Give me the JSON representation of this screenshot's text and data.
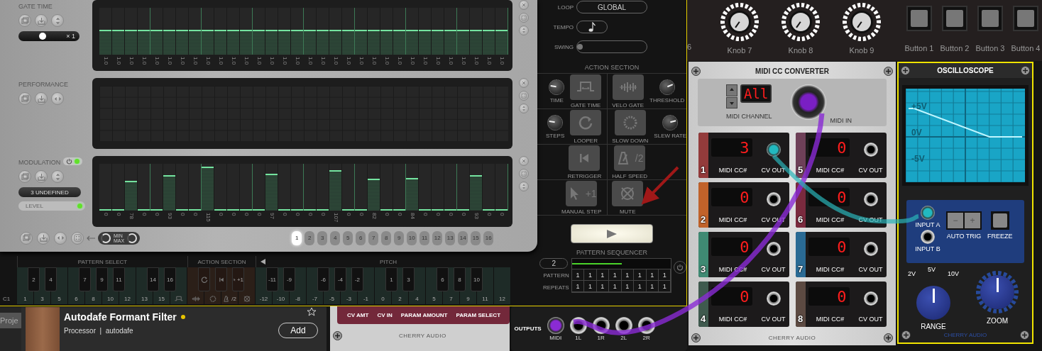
{
  "sequencer": {
    "lanes": [
      {
        "kind": "bars",
        "title": "GATE TIME",
        "scale": {
          "label": "× 1",
          "level": 0.4
        },
        "steps": [
          {
            "label": "1.0",
            "level": 0.5
          },
          {
            "label": "1.0",
            "level": 0.5
          },
          {
            "label": "1.0",
            "level": 0.5
          },
          {
            "label": "1.0",
            "level": 0.5
          },
          {
            "label": "1.0",
            "level": 0.5
          },
          {
            "label": "1.0",
            "level": 0.5
          },
          {
            "label": "1.0",
            "level": 0.5
          },
          {
            "label": "1.0",
            "level": 0.5
          },
          {
            "label": "1.0",
            "level": 0.5
          },
          {
            "label": "1.0",
            "level": 0.5
          },
          {
            "label": "1.0",
            "level": 0.5
          },
          {
            "label": "1.0",
            "level": 0.5
          },
          {
            "label": "1.0",
            "level": 0.5
          },
          {
            "label": "1.0",
            "level": 0.5
          },
          {
            "label": "1.0",
            "level": 0.5
          },
          {
            "label": "1.0",
            "level": 0.5
          },
          {
            "label": "1.0",
            "level": 0.5
          },
          {
            "label": "1.0",
            "level": 0.5
          },
          {
            "label": "1.0",
            "level": 0.5
          },
          {
            "label": "1.0",
            "level": 0.5
          },
          {
            "label": "1.0",
            "level": 0.5
          },
          {
            "label": "1.0",
            "level": 0.5
          },
          {
            "label": "1.0",
            "level": 0.5
          },
          {
            "label": "1.0",
            "level": 0.5
          },
          {
            "label": "1.0",
            "level": 0.5
          },
          {
            "label": "1.0",
            "level": 0.5
          },
          {
            "label": "1.0",
            "level": 0.5
          },
          {
            "label": "1.0",
            "level": 0.5
          },
          {
            "label": "1.0",
            "level": 0.5
          },
          {
            "label": "1.0",
            "level": 0.5
          },
          {
            "label": "1.0",
            "level": 0.5
          },
          {
            "label": "1.0",
            "level": 0.5
          }
        ]
      },
      {
        "kind": "grid",
        "title": "PERFORMANCE"
      },
      {
        "kind": "bars",
        "title": "MODULATION",
        "power": true,
        "source": "3 UNDEFINED",
        "amount": "LEVEL",
        "steps": [
          {
            "label": "0",
            "level": 0
          },
          {
            "label": "0",
            "level": 0
          },
          {
            "label": "78",
            "level": 0.61
          },
          {
            "label": "0",
            "level": 0
          },
          {
            "label": "0",
            "level": 0
          },
          {
            "label": "93",
            "level": 0.73
          },
          {
            "label": "0",
            "level": 0
          },
          {
            "label": "0",
            "level": 0
          },
          {
            "label": "115",
            "level": 0.91
          },
          {
            "label": "0",
            "level": 0
          },
          {
            "label": "0",
            "level": 0
          },
          {
            "label": "0",
            "level": 0
          },
          {
            "label": "0",
            "level": 0
          },
          {
            "label": "97",
            "level": 0.76
          },
          {
            "label": "0",
            "level": 0
          },
          {
            "label": "0",
            "level": 0
          },
          {
            "label": "0",
            "level": 0
          },
          {
            "label": "0",
            "level": 0
          },
          {
            "label": "107",
            "level": 0.84
          },
          {
            "label": "0",
            "level": 0
          },
          {
            "label": "0",
            "level": 0
          },
          {
            "label": "82",
            "level": 0.65
          },
          {
            "label": "0",
            "level": 0
          },
          {
            "label": "0",
            "level": 0
          },
          {
            "label": "84",
            "level": 0.66
          },
          {
            "label": "0",
            "level": 0
          },
          {
            "label": "0",
            "level": 0
          },
          {
            "label": "0",
            "level": 0
          },
          {
            "label": "0",
            "level": 0
          },
          {
            "label": "93",
            "level": 0.73
          },
          {
            "label": "0",
            "level": 0
          },
          {
            "label": "0",
            "level": 0
          }
        ]
      }
    ],
    "range": {
      "min": "MIN",
      "max": "MAX"
    },
    "step_pages": [
      {
        "label": "1",
        "selected": true
      },
      {
        "label": "2",
        "selected": false
      },
      {
        "label": "3",
        "selected": false
      },
      {
        "label": "4",
        "selected": false
      },
      {
        "label": "5",
        "selected": false
      },
      {
        "label": "6",
        "selected": false
      },
      {
        "label": "7",
        "selected": false
      },
      {
        "label": "8",
        "selected": false
      },
      {
        "label": "9",
        "selected": false
      },
      {
        "label": "10",
        "selected": false
      },
      {
        "label": "11",
        "selected": false
      },
      {
        "label": "12",
        "selected": false
      },
      {
        "label": "13",
        "selected": false
      },
      {
        "label": "14",
        "selected": false
      },
      {
        "label": "15",
        "selected": false
      },
      {
        "label": "16",
        "selected": false
      }
    ],
    "loop": {
      "label": "LOOP",
      "value": "GLOBAL"
    },
    "tempo": {
      "label": "TEMPO"
    },
    "swing": {
      "label": "SWING",
      "level": 0
    },
    "action_section": {
      "title": "ACTION SECTION",
      "cells": [
        {
          "button": {
            "label": "GATE TIME"
          },
          "knob": {
            "label": "TIME",
            "level": 0.2
          }
        },
        {
          "button": {
            "label": "VELO GATE"
          },
          "knob": {
            "label": "THRESHOLD",
            "level": 0.75
          }
        },
        {
          "button": {
            "label": "LOOPER"
          },
          "knob": {
            "label": "STEPS",
            "level": 0.2
          }
        },
        {
          "button": {
            "label": "SLOW DOWN"
          },
          "knob": {
            "label": "SLEW RATE",
            "level": 0.78
          }
        },
        {
          "button": {
            "label": "RETRIGGER"
          }
        },
        {
          "button": {
            "label": "HALF SPEED",
            "glyph": "/2"
          }
        },
        {
          "button": {
            "label": "MANUAL STEP",
            "glyph": "+1"
          }
        },
        {
          "button": {
            "label": "MUTE"
          }
        }
      ]
    },
    "pattern_sequencer": {
      "title": "PATTERN SEQUENCER",
      "count": "2",
      "level": 0.5,
      "rows": [
        {
          "label": "PATTERN",
          "cells": [
            "1",
            "1",
            "1",
            "1",
            "1",
            "1",
            "1",
            "1"
          ]
        },
        {
          "label": "REPEATS",
          "cells": [
            "1",
            "1",
            "1",
            "1",
            "1",
            "1",
            "1",
            "1"
          ]
        }
      ]
    },
    "keyboard": {
      "octave_label": "C1",
      "sections": [
        {
          "kind": "pattern",
          "title": "PATTERN SELECT",
          "keys": [
            {
              "kind": "white",
              "label": "1"
            },
            {
              "kind": "black",
              "label": "2"
            },
            {
              "kind": "white",
              "label": "3"
            },
            {
              "kind": "black",
              "label": "4"
            },
            {
              "kind": "white",
              "label": "5"
            },
            {
              "kind": "white",
              "label": "6"
            },
            {
              "kind": "black",
              "label": "7"
            },
            {
              "kind": "white",
              "label": "8"
            },
            {
              "kind": "black",
              "label": "9"
            },
            {
              "kind": "white",
              "label": "10"
            },
            {
              "kind": "black",
              "label": "11"
            },
            {
              "kind": "white",
              "label": "12"
            },
            {
              "kind": "white",
              "label": "13"
            },
            {
              "kind": "black",
              "label": "14"
            },
            {
              "kind": "white",
              "label": "15"
            },
            {
              "kind": "black",
              "label": "16"
            },
            {
              "kind": "white"
            }
          ]
        },
        {
          "kind": "action",
          "title": "ACTION SECTION",
          "keys": [
            {
              "kind": "white"
            },
            {
              "kind": "black"
            },
            {
              "kind": "white"
            },
            {
              "kind": "black"
            },
            {
              "kind": "white",
              "glyph": "/2"
            },
            {
              "kind": "black",
              "glyph": "+1"
            },
            {
              "kind": "white"
            }
          ]
        },
        {
          "kind": "pitch",
          "title": "PITCH",
          "keys": [
            {
              "kind": "white",
              "label": "-12"
            },
            {
              "kind": "black",
              "label": "-11"
            },
            {
              "kind": "white",
              "label": "-10"
            },
            {
              "kind": "black",
              "label": "-9"
            },
            {
              "kind": "white",
              "label": "-8"
            },
            {
              "kind": "white",
              "label": "-7"
            },
            {
              "kind": "black",
              "label": "-6"
            },
            {
              "kind": "white",
              "label": "-5"
            },
            {
              "kind": "black",
              "label": "-4"
            },
            {
              "kind": "white",
              "label": "-3"
            },
            {
              "kind": "black",
              "label": "-2"
            },
            {
              "kind": "white",
              "label": "-1"
            },
            {
              "kind": "white",
              "label": "0"
            },
            {
              "kind": "black",
              "label": "1"
            },
            {
              "kind": "white",
              "label": "2"
            },
            {
              "kind": "black",
              "label": "3"
            },
            {
              "kind": "white",
              "label": "4"
            },
            {
              "kind": "white",
              "label": "5"
            },
            {
              "kind": "black",
              "label": "6"
            },
            {
              "kind": "white",
              "label": "7"
            },
            {
              "kind": "black",
              "label": "8"
            },
            {
              "kind": "white",
              "label": "9"
            },
            {
              "kind": "black",
              "label": "10"
            },
            {
              "kind": "white",
              "label": "11"
            },
            {
              "kind": "white",
              "label": "12"
            }
          ]
        }
      ]
    }
  },
  "browser": {
    "tab": "Proje",
    "item": {
      "title": "Autodafe Formant Filter",
      "new": true,
      "subtitle": "Processor  |  autodafe",
      "button": "Add",
      "favorite": false
    }
  },
  "rack_module": {
    "labels": [
      "CV AMT",
      "CV IN",
      "PARAM AMOUNT",
      "PARAM SELECT"
    ],
    "brand": "CHERRY AUDIO",
    "outputs": {
      "title": "OUTPUTS",
      "jacks": [
        {
          "label": "MIDI",
          "plugged": true
        },
        {
          "label": "1L",
          "plugged": false
        },
        {
          "label": "1R",
          "plugged": false
        },
        {
          "label": "2L",
          "plugged": false
        },
        {
          "label": "2R",
          "plugged": false
        }
      ]
    }
  },
  "controls_rack": {
    "cut_label": "6",
    "knobs": [
      {
        "label": "Knob 7"
      },
      {
        "label": "Knob 8"
      },
      {
        "label": "Knob 9"
      }
    ],
    "buttons": [
      {
        "label": "Button 1",
        "on": false
      },
      {
        "label": "Button 2",
        "on": false
      },
      {
        "label": "Button 3",
        "on": false
      },
      {
        "label": "Button 4",
        "on": false
      }
    ]
  },
  "midi_cc": {
    "title": "MIDI CC CONVERTER",
    "channel_display": "All",
    "channel_label": "MIDI CHANNEL",
    "input_label": "MIDI IN",
    "channels": [
      {
        "number": "1",
        "value": "3",
        "color": "#933b3b",
        "cc_label": "MIDI CC#",
        "out_label": "CV OUT",
        "plugged": true
      },
      {
        "number": "5",
        "value": "0",
        "color": "#6e4058",
        "cc_label": "MIDI CC#",
        "out_label": "CV OUT",
        "plugged": false
      },
      {
        "number": "2",
        "value": "0",
        "color": "#c0622a",
        "cc_label": "MIDI CC#",
        "out_label": "CV OUT",
        "plugged": false
      },
      {
        "number": "6",
        "value": "0",
        "color": "#7a2a3e",
        "cc_label": "MIDI CC#",
        "out_label": "CV OUT",
        "plugged": false
      },
      {
        "number": "3",
        "value": "0",
        "color": "#3f8a73",
        "cc_label": "MIDI CC#",
        "out_label": "CV OUT",
        "plugged": false
      },
      {
        "number": "7",
        "value": "0",
        "color": "#2a6a94",
        "cc_label": "MIDI CC#",
        "out_label": "CV OUT",
        "plugged": false
      },
      {
        "number": "4",
        "value": "0",
        "color": "#3f5a4e",
        "cc_label": "MIDI CC#",
        "out_label": "CV OUT",
        "plugged": false
      },
      {
        "number": "8",
        "value": "0",
        "color": "#5c4a42",
        "cc_label": "MIDI CC#",
        "out_label": "CV OUT",
        "plugged": false
      }
    ],
    "brand": "CHERRY AUDIO"
  },
  "oscilloscope": {
    "title": "OSCILLOSCOPE",
    "scale": [
      "+5V",
      "0V",
      "-5V"
    ],
    "inputs": [
      {
        "label": "INPUT A",
        "plugged": true
      },
      {
        "label": "INPUT B",
        "plugged": false
      }
    ],
    "auto_trig": {
      "label": "AUTO TRIG",
      "minus": "−",
      "plus": "+"
    },
    "freeze": "FREEZE",
    "range": {
      "label": "RANGE",
      "marks": [
        "2V",
        "5V",
        "10V"
      ],
      "level": 0.5
    },
    "zoom": {
      "label": "ZOOM",
      "level": 0.5
    },
    "brand": "CHERRY AUDIO"
  }
}
